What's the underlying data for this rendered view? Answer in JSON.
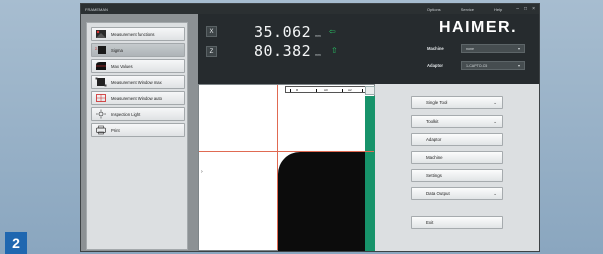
{
  "badge": "2",
  "window": {
    "title": "FRAMEMAN",
    "menu": [
      "Options",
      "Service",
      "Help"
    ],
    "controls": [
      "–",
      "□",
      "×"
    ]
  },
  "left_menu": [
    {
      "label": "Measurement functions",
      "icon": "measurement-functions-icon",
      "selected": false
    },
    {
      "label": "Sigma",
      "icon": "sigma-icon",
      "selected": true
    },
    {
      "label": "Max Values",
      "icon": "max-values-icon",
      "selected": false
    },
    {
      "label": "Measurement Window max",
      "icon": "window-max-icon",
      "selected": false
    },
    {
      "label": "Measurement Window auto",
      "icon": "window-auto-icon",
      "selected": false
    },
    {
      "label": "Inspection Light",
      "icon": "light-icon",
      "selected": false
    },
    {
      "label": "Print",
      "icon": "print-icon",
      "selected": false
    }
  ],
  "readout": {
    "x": {
      "axis": "X",
      "value": "35.062",
      "unit": "mm"
    },
    "z": {
      "axis": "Z",
      "value": "80.382",
      "unit": "mm"
    }
  },
  "brand": {
    "logo": "HAIMER."
  },
  "machine": {
    "label": "Machine",
    "value": "none"
  },
  "adaptor": {
    "label": "Adaptor",
    "value": "1-CAPTO-C5"
  },
  "ruler": {
    "labels": [
      "R",
      "A0",
      "A2"
    ]
  },
  "right_buttons": [
    {
      "label": "Single Tool",
      "has_chevron": true
    },
    {
      "label": "Toolkit",
      "has_chevron": true
    },
    {
      "label": "Adaptor",
      "has_chevron": false
    },
    {
      "label": "Machine",
      "has_chevron": false
    },
    {
      "label": "Settings",
      "has_chevron": false
    },
    {
      "label": "Data Output",
      "has_chevron": true
    },
    {
      "label": "Exit",
      "has_chevron": false
    }
  ],
  "colors": {
    "accent_green": "#17936a",
    "arrow_green": "#29c465",
    "crosshair": "#e06a52"
  }
}
